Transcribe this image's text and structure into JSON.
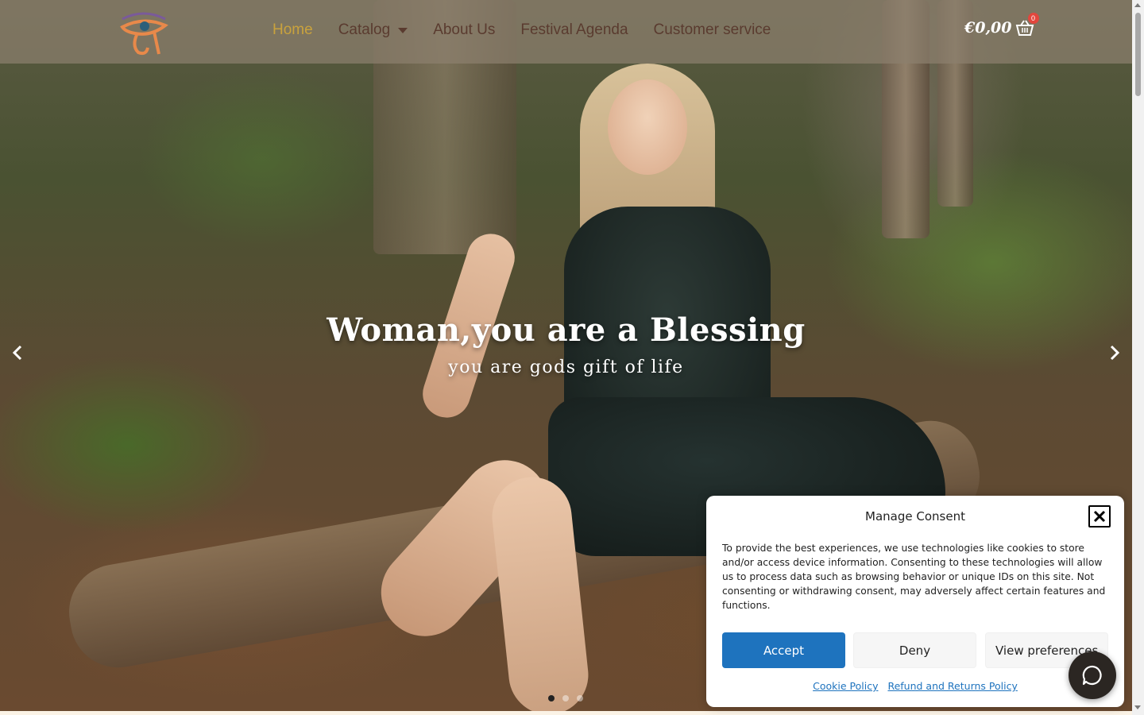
{
  "header": {
    "logo_icon": "eye-of-horus-icon",
    "nav": [
      {
        "label": "Home",
        "active": true
      },
      {
        "label": "Catalog",
        "has_dropdown": true
      },
      {
        "label": "About Us"
      },
      {
        "label": "Festival Agenda"
      },
      {
        "label": "Customer service"
      }
    ],
    "cart": {
      "total": "€0,00",
      "count": "0",
      "icon": "basket-icon"
    }
  },
  "hero": {
    "title": "Woman,you are a Blessing",
    "subtitle": "you are gods gift of life",
    "prev_icon": "chevron-left-icon",
    "next_icon": "chevron-right-icon",
    "slides_total": 3,
    "active_slide": 1
  },
  "consent": {
    "title": "Manage Consent",
    "close_icon": "close-icon",
    "text": "To provide the best experiences, we use technologies like cookies to store and/or access device information. Consenting to these technologies will allow us to process data such as browsing behavior or unique IDs on this site. Not consenting or withdrawing consent, may adversely affect certain features and functions.",
    "accept_label": "Accept",
    "deny_label": "Deny",
    "preferences_label": "View preferences",
    "links": [
      "Cookie Policy",
      "Refund and Returns Policy"
    ]
  },
  "chat": {
    "icon": "chat-bubble-icon"
  },
  "colors": {
    "accent_gold": "#c9a23d",
    "nav_text": "#5a3b2f",
    "accept_blue": "#1e73be",
    "badge_red": "#e2463d"
  }
}
